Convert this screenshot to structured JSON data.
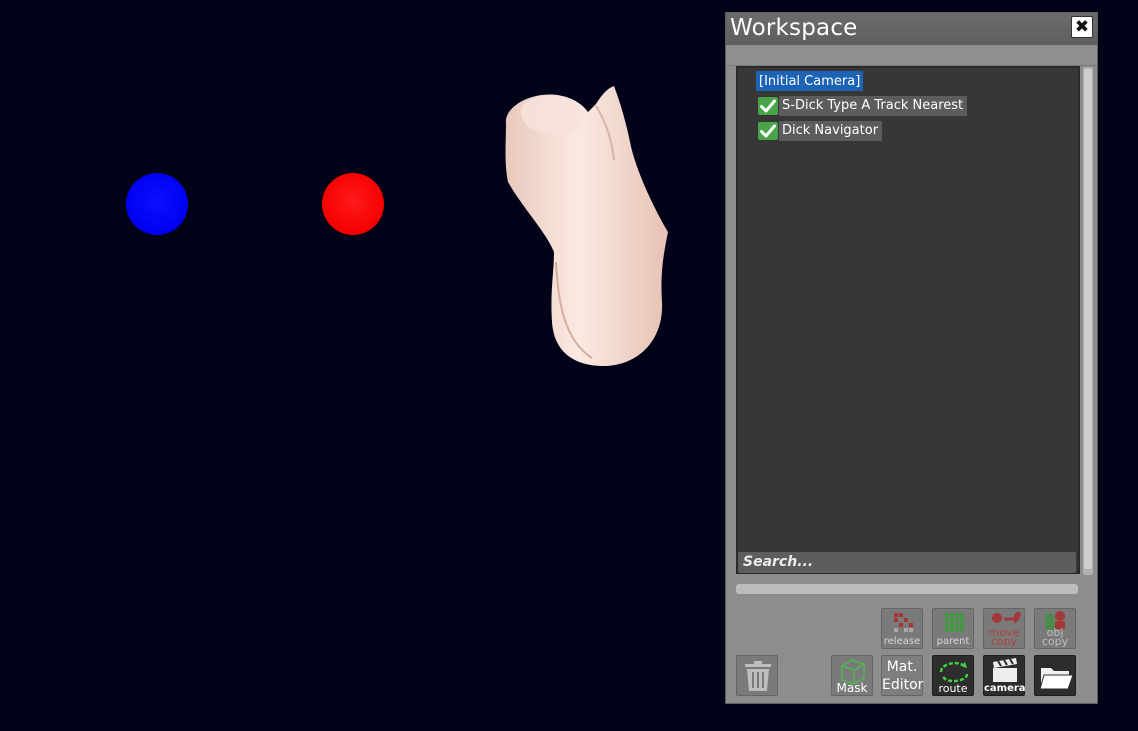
{
  "panel": {
    "title": "Workspace",
    "close_icon": "close-icon"
  },
  "tree": {
    "items": [
      {
        "label": "[Initial Camera]",
        "checked": false,
        "selected": true
      },
      {
        "label": "S-Dick Type A Track Nearest",
        "checked": true,
        "selected": false
      },
      {
        "label": "Dick Navigator",
        "checked": true,
        "selected": false
      }
    ]
  },
  "search": {
    "placeholder": "Search..."
  },
  "toolbar": {
    "row1": [
      {
        "name": "release",
        "label": "release",
        "icon": "release-icon"
      },
      {
        "name": "parent",
        "label": "parent",
        "icon": "parent-grid-icon"
      },
      {
        "name": "move-copy",
        "label": "move\ncopy",
        "line1": "move",
        "line2": "copy",
        "icon": "move-copy-icon"
      },
      {
        "name": "obj-copy",
        "label": "obj\ncopy",
        "line1": "obj",
        "line2": "copy",
        "icon": "obj-copy-icon"
      }
    ],
    "row2": [
      {
        "name": "trash",
        "icon": "trash-icon"
      },
      {
        "name": "mask",
        "label": "Mask",
        "icon": "mask-cube-icon"
      },
      {
        "name": "mat-editor",
        "line1": "Mat.",
        "line2": "Editor"
      },
      {
        "name": "route",
        "label": "route",
        "icon": "route-icon"
      },
      {
        "name": "camera",
        "label": "camera",
        "icon": "clapperboard-icon"
      },
      {
        "name": "folder",
        "icon": "folder-icon"
      }
    ]
  },
  "colors": {
    "background": "#020318",
    "blue_marker": "#0000f0",
    "red_marker": "#f50000",
    "selection": "#1c63b6",
    "check": "#47a447"
  }
}
